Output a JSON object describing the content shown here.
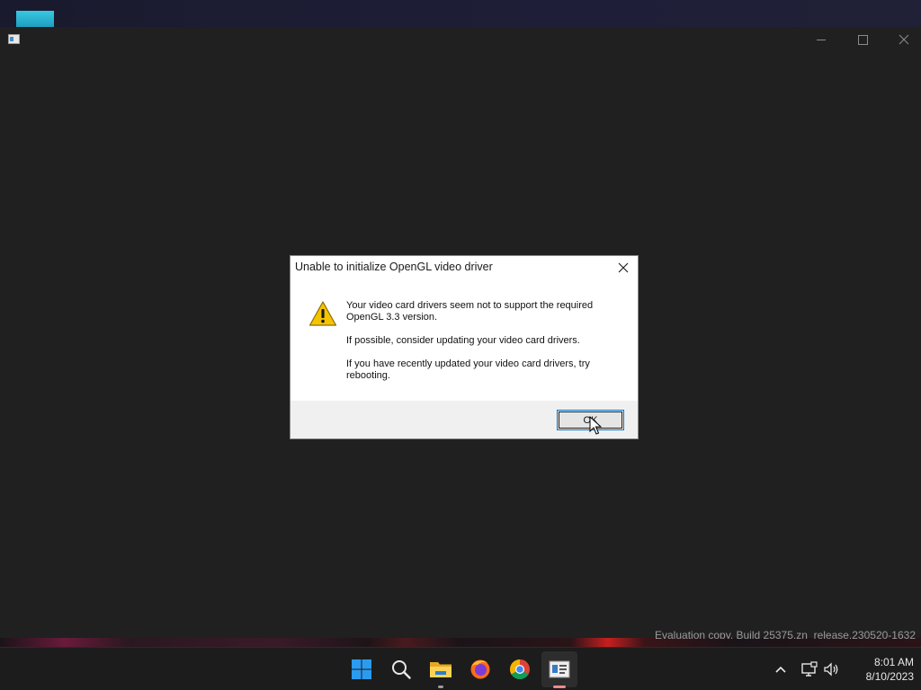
{
  "app_window": {
    "controls": {
      "minimize": "minimize-icon",
      "maximize": "maximize-icon",
      "close": "close-icon"
    }
  },
  "dialog": {
    "title": "Unable to initialize OpenGL video driver",
    "icon": "warning-icon",
    "message_lines": [
      "Your video card drivers seem not to support the required OpenGL 3.3 version.",
      "If possible, consider updating your video card drivers.",
      "If you have recently updated your video card drivers, try rebooting."
    ],
    "ok_label": "OK"
  },
  "watermark": "Evaluation copy. Build 25375.zn_release.230520-1632",
  "taskbar": {
    "icons": [
      "windows-start-icon",
      "search-icon",
      "file-explorer-icon",
      "firefox-icon",
      "chrome-icon",
      "app-window-icon"
    ],
    "tray_icons": [
      "chevron-up-icon",
      "network-icon",
      "volume-icon"
    ],
    "time": "8:01 AM",
    "date": "8/10/2023"
  },
  "colors": {
    "accent": "#0078d7",
    "window_bg": "#202020",
    "warning_yellow": "#f5c400"
  }
}
